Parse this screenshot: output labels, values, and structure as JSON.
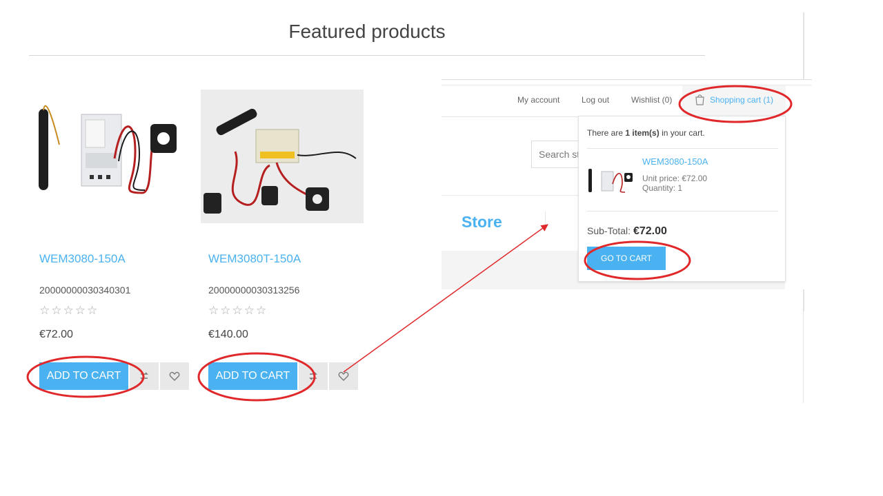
{
  "featured": {
    "title": "Featured products",
    "products": [
      {
        "name": "WEM3080-150A",
        "sku": "20000000030340301",
        "stars": "☆☆☆☆☆",
        "price": "€72.00",
        "add_label": "ADD TO CART"
      },
      {
        "name": "WEM3080T-150A",
        "sku": "20000000030313256",
        "stars": "☆☆☆☆☆",
        "price": "€140.00",
        "add_label": "ADD TO CART"
      }
    ]
  },
  "header": {
    "links": [
      "My account",
      "Log out",
      "Wishlist (0)"
    ],
    "cart_label": "Shopping cart (1)",
    "search_placeholder": "Search st",
    "store_name": "Store"
  },
  "flyout": {
    "count_prefix": "There are",
    "count_value": "1 item(s)",
    "count_suffix": "in your cart.",
    "item": {
      "name": "WEM3080-150A",
      "unit_price": "Unit price: €72.00",
      "quantity": "Quantity: 1"
    },
    "subtotal_label": "Sub-Total:",
    "subtotal_value": "€72.00",
    "go_label": "GO TO CART"
  },
  "icons": {
    "compare": "compare-icon",
    "wishlist": "heart-icon",
    "cart": "shopping-bag-icon"
  },
  "colors": {
    "accent": "#4ab2f1",
    "annotation": "#e0282b"
  }
}
